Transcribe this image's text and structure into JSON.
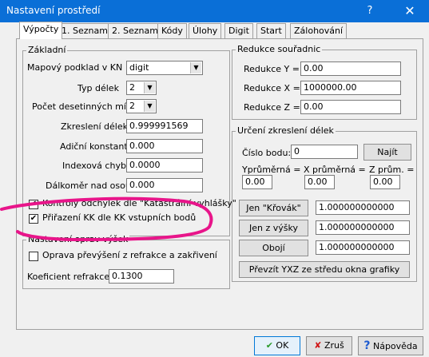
{
  "window": {
    "title": "Nastavení prostředí",
    "help_glyph": "?",
    "close_glyph": "✕"
  },
  "tabs": [
    {
      "label": "Výpočty"
    },
    {
      "label": "1. Seznam"
    },
    {
      "label": "2. Seznam"
    },
    {
      "label": "Kódy"
    },
    {
      "label": "Úlohy"
    },
    {
      "label": "Digit"
    },
    {
      "label": "Start"
    },
    {
      "label": "Zálohování"
    }
  ],
  "zakladni": {
    "legend": "Základní",
    "mapovy_label": "Mapový podklad v KN :",
    "mapovy_value": "digit",
    "typ_delek_label": "Typ délek",
    "typ_delek_value": "2",
    "pocet_label": "Počet desetinných míst",
    "pocet_value": "2",
    "zkresleni_label": "Zkreslení délek",
    "zkresleni_value": "0.999991569",
    "adicni_label": "Adiční konstanta",
    "adicni_value": "0.000",
    "indexova_label": "Indexová chyba",
    "indexova_value": "0.0000",
    "dalkomer_label": "Dálkoměr nad osou",
    "dalkomer_value": "0.000",
    "kontroly_label": "Kontroly odchylek dle \"Katastrální vyhlášky\"",
    "prirazeni_label": "Přiřazení KK dle KK vstupních bodů"
  },
  "oprav": {
    "legend": "Nastavení oprav výšek",
    "oprava_label": "Oprava převýšení z refrakce a zakřivení",
    "koef_label": "Koeficient refrakce:",
    "koef_value": "0.1300"
  },
  "redukce": {
    "legend": "Redukce souřadnic",
    "y_label": "Redukce Y =",
    "y_value": "0.00",
    "x_label": "Redukce X =",
    "x_value": "1000000.00",
    "z_label": "Redukce Z =",
    "z_value": "0.00"
  },
  "urceni": {
    "legend": "Určení zkreslení délek",
    "cislo_label": "Číslo bodu:",
    "cislo_value": "0",
    "najit_label": "Najít",
    "yprum_label": "Yprůměrná =",
    "yprum_value": "0.00",
    "xprum_label": "X průměrná =",
    "xprum_value": "0.00",
    "zprum_label": "Z prům. =",
    "zprum_value": "0.00",
    "jen_krovak_label": "Jen \"Křovák\"",
    "jen_krovak_value": "1.000000000000",
    "jen_vysky_label": "Jen z výšky",
    "jen_vysky_value": "1.000000000000",
    "oboji_label": "Obojí",
    "oboji_value": "1.000000000000",
    "prevzit_label": "Převzít YXZ ze středu okna grafiky"
  },
  "footer": {
    "ok_label": "OK",
    "zrus_label": "Zruš",
    "napoveda_label": "Nápověda"
  },
  "colors": {
    "titlebar": "#0a6fd7",
    "annotation": "#e8158a"
  }
}
